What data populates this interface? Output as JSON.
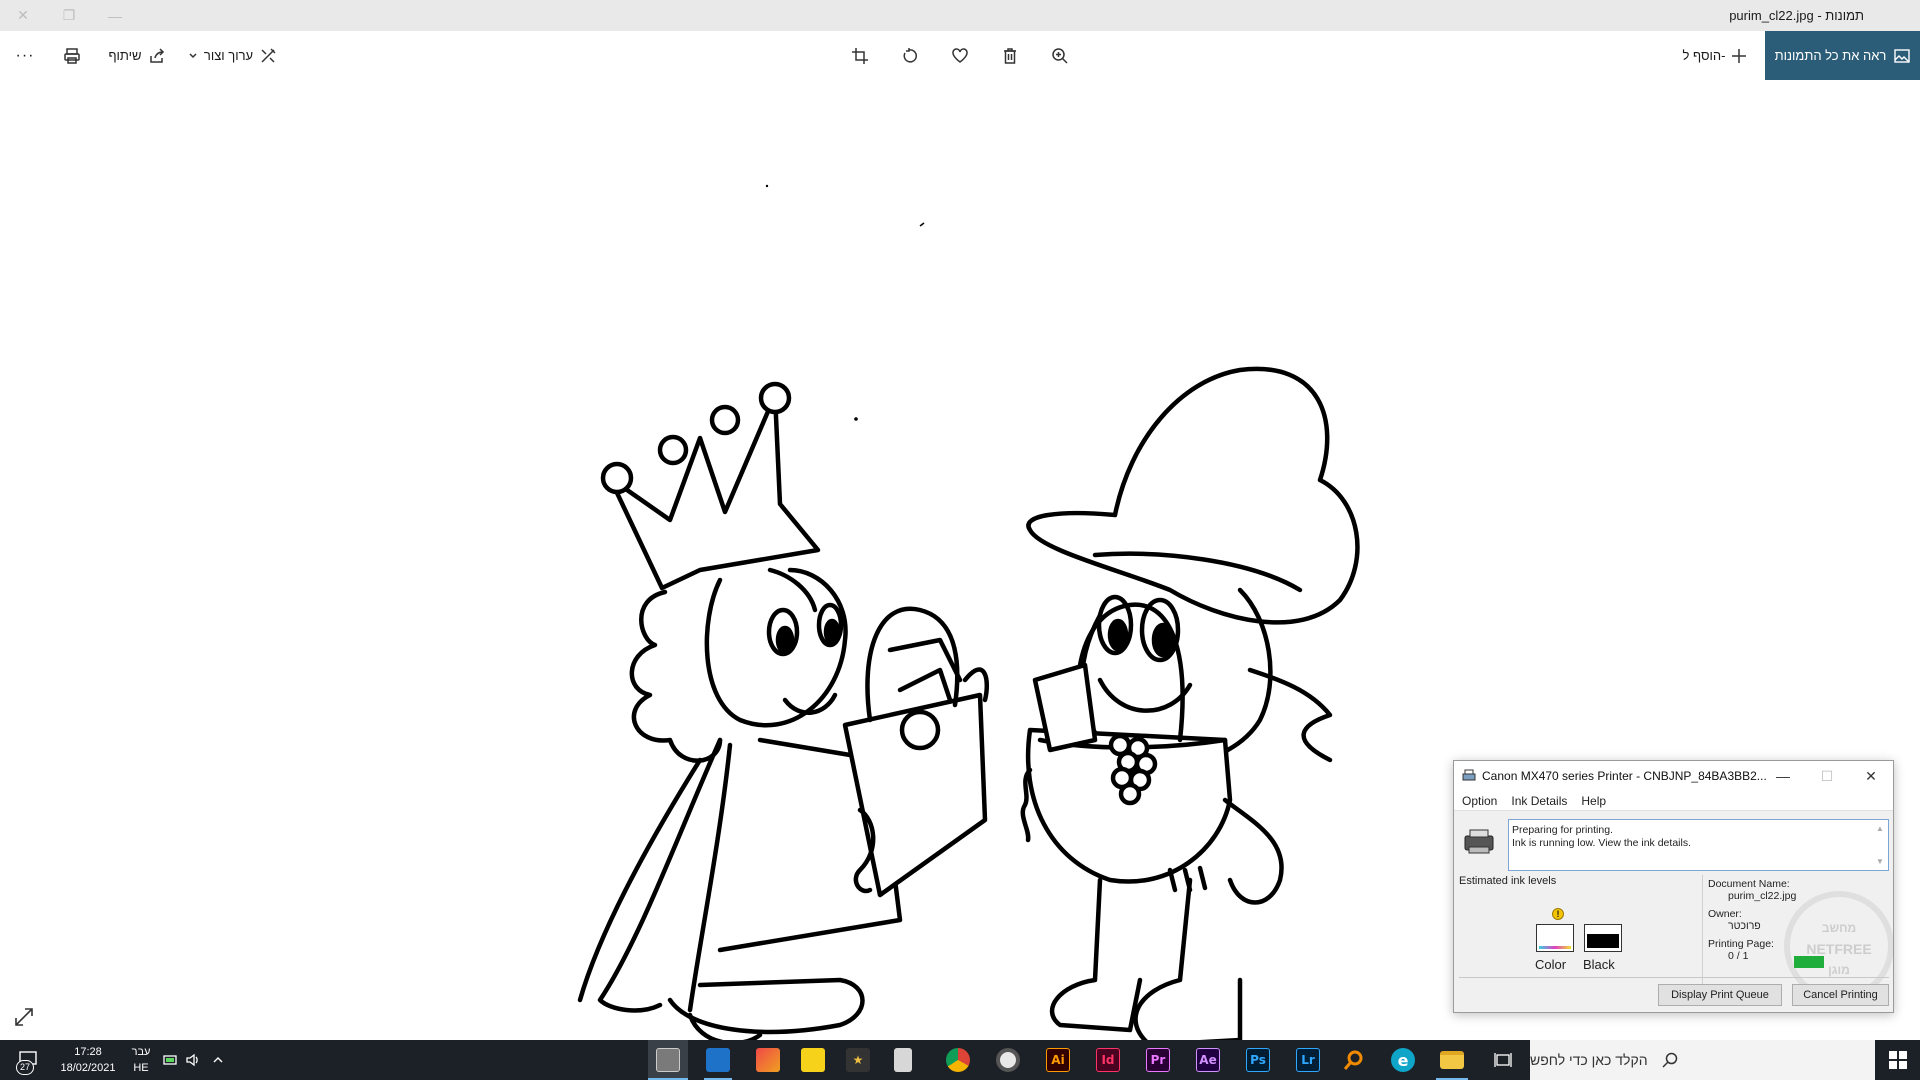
{
  "window": {
    "title": "תמונות - purim_cl22.jpg"
  },
  "toolbar": {
    "see_all_label": "ראה את כל התמונות",
    "add_to_label": "הוסף ל-",
    "edit_create_label": "ערוך וצור",
    "share_label": "שיתוף",
    "more_label": "···"
  },
  "printer_dialog": {
    "title": "Canon MX470 series Printer - CNBJNP_84BA3BB2...",
    "menu": [
      "Option",
      "Ink Details",
      "Help"
    ],
    "status_line1": "Preparing for printing.",
    "status_line2": "Ink is running low. View the ink details.",
    "ink_levels_label": "Estimated ink levels",
    "ink_color_label": "Color",
    "ink_black_label": "Black",
    "document_name_label": "Document Name:",
    "document_name": "purim_cl22.jpg",
    "owner_label": "Owner:",
    "owner": "פרוכטר",
    "printing_page_label": "Printing Page:",
    "printing_page": "0 / 1",
    "display_queue_button": "Display Print Queue",
    "cancel_button": "Cancel Printing",
    "watermark_text_top": "מחשב",
    "watermark_text_mid": "NETFREE",
    "watermark_text_bottom": "מוגן"
  },
  "taskbar": {
    "search_placeholder": "הקלד כאן כדי לחפש",
    "time": "17:28",
    "date": "18/02/2021",
    "lang_top": "עבר",
    "lang_bottom": "HE",
    "notification_count": "27",
    "apps": [
      "printer",
      "photos",
      "paint-3d",
      "sticky-notes",
      "movie-maker",
      "calculator",
      "chrome",
      "media-player",
      "illustrator",
      "indesign",
      "premiere",
      "after-effects",
      "photoshop",
      "lightroom",
      "search-tool",
      "edge",
      "file-explorer",
      "task-view"
    ],
    "app_labels": {
      "illustrator": "Ai",
      "indesign": "Id",
      "premiere": "Pr",
      "after_effects": "Ae",
      "photoshop": "Ps",
      "lightroom": "Lr",
      "edge": "e"
    }
  }
}
